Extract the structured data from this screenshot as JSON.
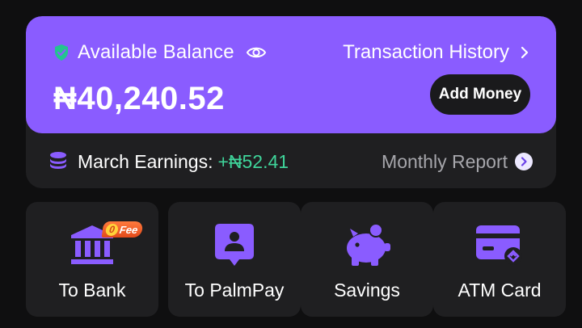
{
  "balance": {
    "label": "Available Balance",
    "amount": "₦40,240.52",
    "history_link": "Transaction History",
    "add_money": "Add Money",
    "eye_icon": "eye-icon",
    "shield_icon": "shield-check-icon"
  },
  "earnings": {
    "label": "March Earnings:",
    "value": "+₦52.41",
    "report_link": "Monthly Report"
  },
  "actions": [
    {
      "label": "To Bank",
      "icon": "bank-icon",
      "badge": {
        "zero": "0",
        "text": "Fee"
      }
    },
    {
      "label": "To PalmPay",
      "icon": "palmpay-transfer-icon"
    },
    {
      "label": "Savings",
      "icon": "piggy-bank-icon"
    },
    {
      "label": "ATM Card",
      "icon": "atm-card-icon"
    }
  ],
  "colors": {
    "accent": "#8a5cff",
    "positive": "#3fd49a",
    "card_bg": "#1f1f21",
    "page_bg": "#0f0f10"
  }
}
